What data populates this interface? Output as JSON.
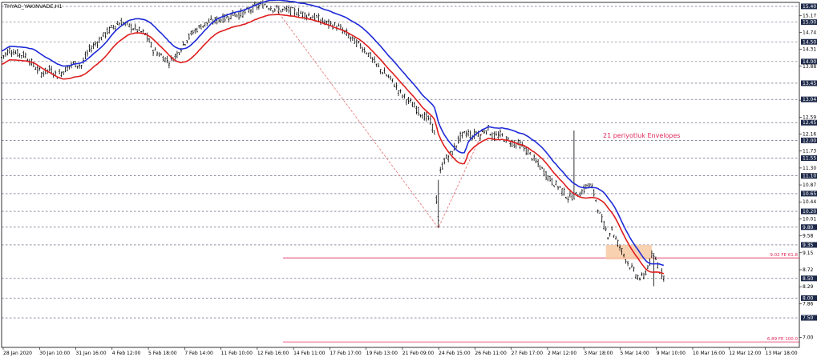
{
  "chart_data": {
    "type": "line",
    "title": "THYAO_YAKINVADE,H1",
    "annotation": "21 periyotluk Envelopes",
    "colors": {
      "candles": "#000000",
      "upper_envelope": "#1f2bd8",
      "lower_envelope": "#e01e1e",
      "fib_lines": "#e0285a",
      "zigzag": "#e87070",
      "zone_fill": "#f7c9a3",
      "grid": "#4a4a6a",
      "price_box": "#1e2a4a"
    },
    "ylim": [
      6.75,
      15.5
    ],
    "x_tick_labels": [
      "28 Jan 2020",
      "30 Jan 10:00",
      "31 Jan 16:00",
      "4 Feb 12:00",
      "5 Feb 18:00",
      "7 Feb 14:00",
      "11 Feb 10:00",
      "12 Feb 16:00",
      "14 Feb 11:00",
      "17 Feb 17:00",
      "19 Feb 13:00",
      "21 Feb 09:00",
      "24 Feb 15:00",
      "26 Feb 11:00",
      "27 Feb 17:00",
      "2 Mar 12:00",
      "3 Mar 18:00",
      "5 Mar 14:00",
      "9 Mar 10:00",
      "10 Mar 16:00",
      "12 Mar 12:00",
      "13 Mar 18:00"
    ],
    "y_ticks_plain": [
      {
        "value": 15.17,
        "label": "15.17"
      },
      {
        "value": 14.74,
        "label": "14.74"
      },
      {
        "value": 14.31,
        "label": "14.31"
      },
      {
        "value": 13.88,
        "label": "13.88"
      },
      {
        "value": 13.02,
        "label": "13.02"
      },
      {
        "value": 12.59,
        "label": "12.59"
      },
      {
        "value": 12.16,
        "label": "12.16"
      },
      {
        "value": 11.73,
        "label": "11.73"
      },
      {
        "value": 11.3,
        "label": "11.30"
      },
      {
        "value": 10.87,
        "label": "10.87"
      },
      {
        "value": 10.44,
        "label": "10.44"
      },
      {
        "value": 10.01,
        "label": "10.01"
      },
      {
        "value": 9.58,
        "label": "9.58"
      },
      {
        "value": 9.15,
        "label": "9.15"
      },
      {
        "value": 8.72,
        "label": "8.72"
      },
      {
        "value": 8.29,
        "label": "8.29"
      },
      {
        "value": 7.86,
        "label": "7.86"
      },
      {
        "value": 7.0,
        "label": "7.00"
      }
    ],
    "price_levels": [
      {
        "value": 15.4,
        "label": "15.40"
      },
      {
        "value": 15.0,
        "label": "15.00"
      },
      {
        "value": 14.5,
        "label": "14.50"
      },
      {
        "value": 14.0,
        "label": "14.00"
      },
      {
        "value": 13.45,
        "label": "13.45"
      },
      {
        "value": 13.04,
        "label": "13.04"
      },
      {
        "value": 12.45,
        "label": "12.45"
      },
      {
        "value": 12.0,
        "label": "12.00"
      },
      {
        "value": 11.55,
        "label": "11.55"
      },
      {
        "value": 11.1,
        "label": "11.10"
      },
      {
        "value": 10.65,
        "label": "10.65"
      },
      {
        "value": 10.2,
        "label": "10.20"
      },
      {
        "value": 9.8,
        "label": "9.80"
      },
      {
        "value": 9.35,
        "label": "9.35"
      },
      {
        "value": 8.5,
        "label": "8.50"
      },
      {
        "value": 8.0,
        "label": "8.00"
      },
      {
        "value": 7.5,
        "label": "7.50"
      }
    ],
    "fib_levels": [
      {
        "value": 9.02,
        "label": "9.02 FE 61.8"
      },
      {
        "value": 6.89,
        "label": "6.89 FE 100.0"
      }
    ],
    "zone": {
      "x_from": 151.5,
      "x_to": 163,
      "y_from": 8.98,
      "y_to": 9.35
    },
    "zigzag": [
      {
        "x": 69,
        "y": 15.3
      },
      {
        "x": 109.5,
        "y": 9.78
      },
      {
        "x": 121,
        "y": 12.3
      }
    ],
    "price_path": [
      [
        0,
        14.1
      ],
      [
        2,
        14.3
      ],
      [
        4,
        14.2
      ],
      [
        6,
        14.15
      ],
      [
        8,
        13.9
      ],
      [
        10,
        13.7
      ],
      [
        12,
        13.8
      ],
      [
        14,
        13.65
      ],
      [
        16,
        13.8
      ],
      [
        18,
        13.95
      ],
      [
        20,
        13.9
      ],
      [
        22,
        14.3
      ],
      [
        24,
        14.5
      ],
      [
        26,
        14.7
      ],
      [
        28,
        14.9
      ],
      [
        30,
        15.0
      ],
      [
        32,
        14.9
      ],
      [
        34,
        14.8
      ],
      [
        36,
        14.7
      ],
      [
        38,
        14.3
      ],
      [
        40,
        14.15
      ],
      [
        42,
        14.0
      ],
      [
        44,
        14.2
      ],
      [
        46,
        14.5
      ],
      [
        48,
        14.75
      ],
      [
        50,
        14.9
      ],
      [
        52,
        15.0
      ],
      [
        54,
        15.05
      ],
      [
        56,
        15.1
      ],
      [
        58,
        15.2
      ],
      [
        60,
        15.2
      ],
      [
        62,
        15.3
      ],
      [
        64,
        15.4
      ],
      [
        66,
        15.45
      ],
      [
        68,
        15.35
      ],
      [
        70,
        15.3
      ],
      [
        72,
        15.3
      ],
      [
        74,
        15.25
      ],
      [
        76,
        15.2
      ],
      [
        78,
        15.15
      ],
      [
        80,
        15.05
      ],
      [
        82,
        14.95
      ],
      [
        84,
        14.9
      ],
      [
        86,
        14.75
      ],
      [
        88,
        14.55
      ],
      [
        90,
        14.4
      ],
      [
        92,
        14.2
      ],
      [
        94,
        13.9
      ],
      [
        96,
        13.7
      ],
      [
        98,
        13.5
      ],
      [
        100,
        13.2
      ],
      [
        102,
        13.0
      ],
      [
        104,
        12.8
      ],
      [
        106,
        12.6
      ],
      [
        107,
        12.55
      ],
      [
        108,
        12.35
      ],
      [
        108.5,
        12.2
      ],
      [
        109,
        10.5
      ],
      [
        109.5,
        10.0
      ],
      [
        110,
        11.2
      ],
      [
        111,
        11.5
      ],
      [
        112,
        11.6
      ],
      [
        113,
        11.7
      ],
      [
        114,
        11.9
      ],
      [
        115,
        12.1
      ],
      [
        116,
        12.15
      ],
      [
        117,
        12.2
      ],
      [
        118,
        12.1
      ],
      [
        119,
        12.2
      ],
      [
        120,
        12.15
      ],
      [
        121,
        12.25
      ],
      [
        122,
        12.3
      ],
      [
        123,
        12.1
      ],
      [
        124,
        12.1
      ],
      [
        125,
        12.15
      ],
      [
        126,
        12.05
      ],
      [
        128,
        11.95
      ],
      [
        130,
        11.9
      ],
      [
        132,
        11.7
      ],
      [
        134,
        11.45
      ],
      [
        136,
        11.2
      ],
      [
        138,
        10.95
      ],
      [
        140,
        10.8
      ],
      [
        142,
        10.55
      ],
      [
        144,
        10.6
      ],
      [
        146,
        10.75
      ],
      [
        147,
        10.9
      ],
      [
        148,
        10.8
      ],
      [
        149,
        10.5
      ],
      [
        150,
        10.1
      ],
      [
        151,
        9.85
      ],
      [
        152,
        9.6
      ],
      [
        153,
        9.75
      ],
      [
        154,
        9.5
      ],
      [
        155,
        9.3
      ],
      [
        156,
        9.1
      ],
      [
        157,
        8.9
      ],
      [
        158,
        8.75
      ],
      [
        159,
        8.6
      ],
      [
        160,
        8.5
      ],
      [
        161,
        8.55
      ],
      [
        162,
        8.8
      ],
      [
        163,
        9.05
      ],
      [
        164,
        9.0
      ],
      [
        165,
        8.7
      ],
      [
        166,
        8.55
      ]
    ]
  }
}
